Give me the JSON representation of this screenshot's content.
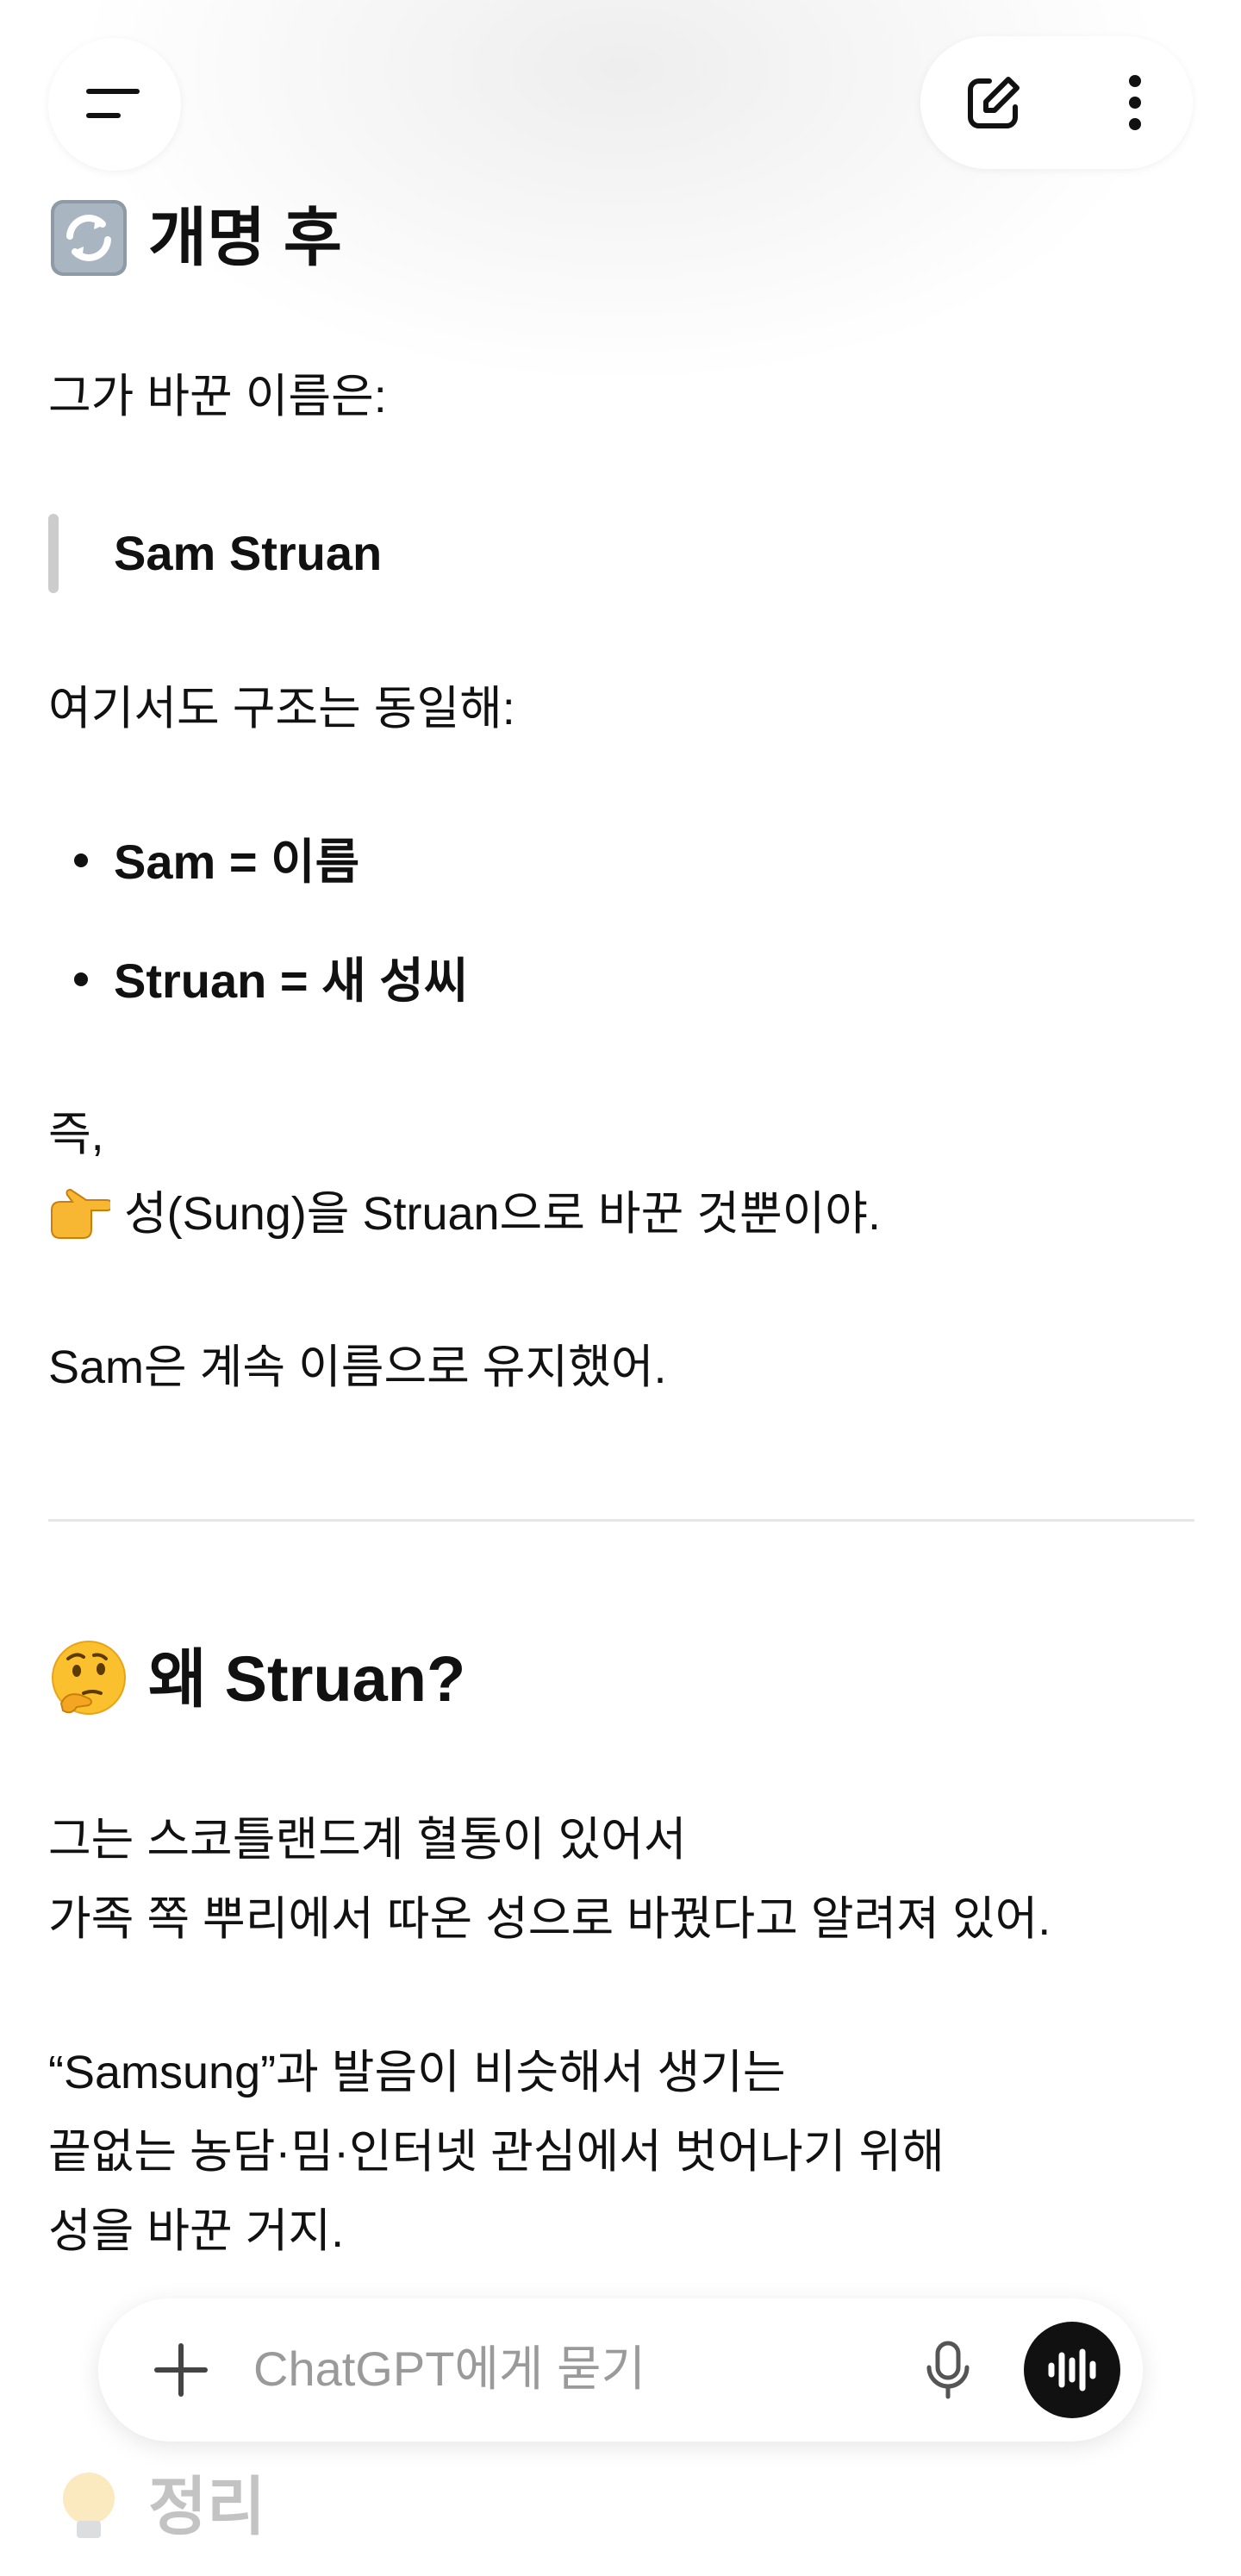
{
  "header": {
    "menu_icon": "menu-icon",
    "edit_icon": "new-chat-edit-icon",
    "more_icon": "more-vertical-icon"
  },
  "section1": {
    "icon": "arrows-counterclockwise-emoji",
    "title": "개명 후",
    "intro": "그가 바꾼 이름은:",
    "quote": "Sam Struan",
    "structure_line": "여기서도 구조는 동일해:",
    "bullets": [
      "Sam = 이름",
      "Struan = 새 성씨"
    ],
    "summary_line1": "즉,",
    "summary_icon": "pointing-right-emoji",
    "summary_line2": "성(Sung)을 Struan으로 바꾼 것뿐이야.",
    "closing": "Sam은 계속 이름으로 유지했어."
  },
  "section2": {
    "icon": "thinking-face-emoji",
    "title": "왜 Struan?",
    "para1_line1": "그는 스코틀랜드계 혈통이 있어서",
    "para1_line2": "가족 쪽 뿌리에서 따온 성으로 바꿨다고 알려져 있어.",
    "para2_line1": "“Samsung”과 발음이 비슷해서 생기는",
    "para2_line2": "끝없는 농담·밈·인터넷 관심에서 벗어나기 위해",
    "para2_line3": "성을 바꾼 거지."
  },
  "section3": {
    "icon": "light-bulb-emoji",
    "title": "정리"
  },
  "composer": {
    "placeholder": "ChatGPT에게 묻기",
    "plus_icon": "plus-icon",
    "mic_icon": "microphone-icon",
    "voice_icon": "voice-mode-icon"
  }
}
